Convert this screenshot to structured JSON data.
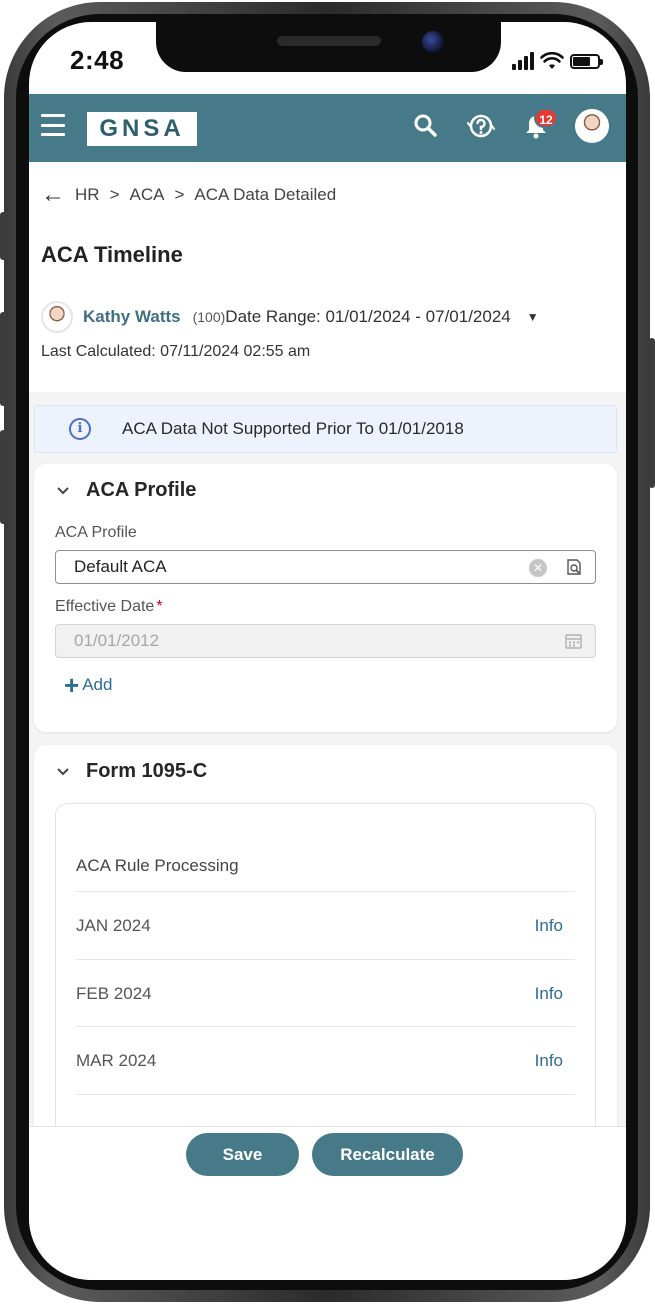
{
  "status_bar": {
    "time": "2:48"
  },
  "header": {
    "logo": "GNSA",
    "notification_count": "12",
    "accent_color": "#477a89",
    "icons": [
      "menu-icon",
      "search-icon",
      "help-icon",
      "bell-icon",
      "avatar"
    ]
  },
  "breadcrumb": {
    "items": [
      "HR",
      "ACA",
      "ACA Data Detailed"
    ],
    "separator": ">"
  },
  "page": {
    "title": "ACA Timeline"
  },
  "employee": {
    "name": "Kathy Watts",
    "id": "(100)",
    "date_range": "Date Range: 01/01/2024 - 07/01/2024",
    "last_calculated": "Last Calculated: 07/11/2024 02:55 am"
  },
  "info_banner": {
    "text": "ACA Data Not Supported Prior To 01/01/2018"
  },
  "aca_profile": {
    "title": "ACA Profile",
    "profile_label": "ACA Profile",
    "profile_value": "Default ACA",
    "effective_date_label": "Effective Date",
    "required_mark": "*",
    "effective_date_value": "01/01/2012",
    "add_label": "Add"
  },
  "form_1095c": {
    "title": "Form 1095-C",
    "section_title": "ACA Rule Processing",
    "months": [
      {
        "label": "JAN 2024",
        "action": "Info"
      },
      {
        "label": "FEB 2024",
        "action": "Info"
      },
      {
        "label": "MAR 2024",
        "action": "Info"
      }
    ]
  },
  "footer": {
    "save_label": "Save",
    "recalculate_label": "Recalculate"
  }
}
